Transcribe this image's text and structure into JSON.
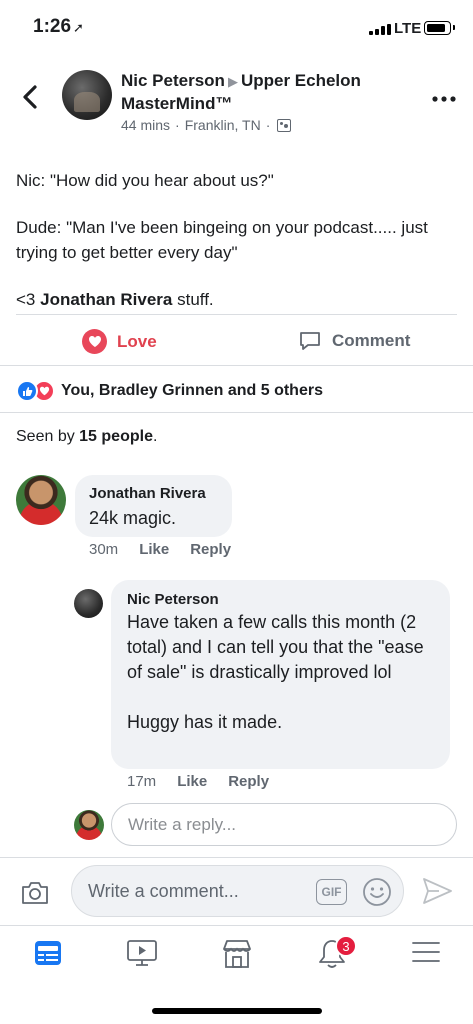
{
  "status_bar": {
    "time": "1:26",
    "location_arrow": "location-arrow-icon",
    "network": "LTE"
  },
  "post": {
    "author": "Nic Peterson",
    "group": "Upper Echelon MasterMind™",
    "time": "44 mins",
    "location": "Franklin, TN",
    "text": {
      "line1": "Nic: \"How did you hear about us?\"",
      "line2": "Dude: \"Man I've been bingeing on your podcast..... just trying to get better every day\"",
      "line3_prefix": "<3 ",
      "line3_name": "Jonathan Rivera",
      "line3_suffix": " stuff."
    }
  },
  "actions": {
    "love": "Love",
    "comment": "Comment"
  },
  "reactions": {
    "summary": "You, Bradley Grinnen and 5 others"
  },
  "seen": {
    "prefix": "Seen by ",
    "count": "15 people",
    "suffix": "."
  },
  "comments": [
    {
      "author": "Jonathan Rivera",
      "text": "24k magic.",
      "time": "30m",
      "like": "Like",
      "reply": "Reply"
    }
  ],
  "replies": [
    {
      "author": "Nic Peterson",
      "text_1": "Have taken a few calls this month (2 total) and I can tell you that the \"ease of sale\" is drastically improved lol",
      "text_2": "Huggy has it made.",
      "time": "17m",
      "like": "Like",
      "reply": "Reply"
    }
  ],
  "reply_input": {
    "placeholder": "Write a reply..."
  },
  "composer": {
    "placeholder": "Write a comment...",
    "gif": "GIF"
  },
  "tab_bar": {
    "notifications_badge": "3"
  },
  "colors": {
    "love": "#e0424f",
    "like_blue": "#1877f2",
    "tab_active": "#1877f2",
    "badge": "#e41e3f"
  }
}
